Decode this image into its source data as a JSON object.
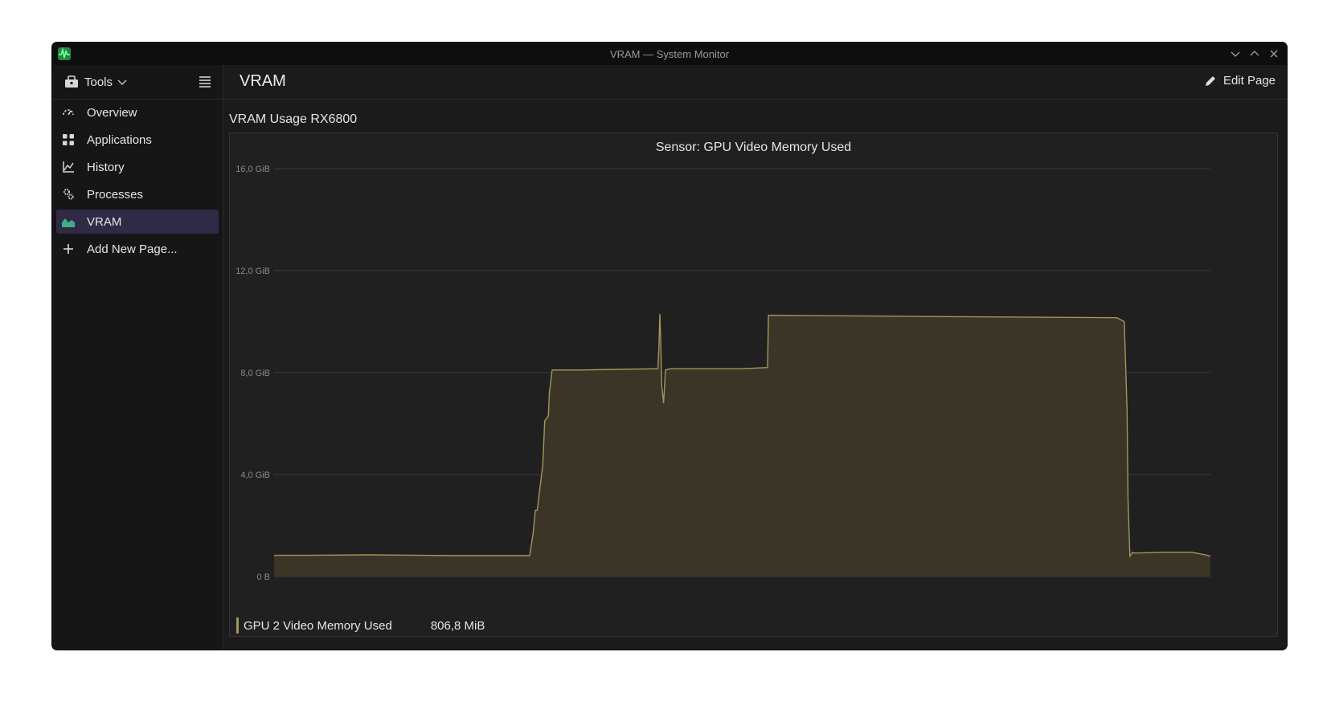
{
  "window": {
    "title": "VRAM — System Monitor"
  },
  "sidebar": {
    "tools_label": "Tools",
    "items": [
      {
        "label": "Overview",
        "icon": "overview-icon"
      },
      {
        "label": "Applications",
        "icon": "applications-grid-icon"
      },
      {
        "label": "History",
        "icon": "history-chart-icon"
      },
      {
        "label": "Processes",
        "icon": "processes-gear-icon"
      },
      {
        "label": "VRAM",
        "icon": "vram-area-chart-icon",
        "active": true
      },
      {
        "label": "Add New Page...",
        "icon": "plus-icon"
      }
    ]
  },
  "header": {
    "page_title": "VRAM",
    "edit_label": "Edit Page"
  },
  "section": {
    "title": "VRAM Usage RX6800"
  },
  "chart_data": {
    "type": "area",
    "title": "Sensor: GPU Video Memory Used",
    "ylabel": "",
    "xlabel": "",
    "ylim": [
      0,
      16
    ],
    "yticks": [
      "16,0 GiB",
      "12,0 GiB",
      "8,0 GiB",
      "4,0 GiB",
      "0 B"
    ],
    "ytick_values": [
      16,
      12,
      8,
      4,
      0
    ],
    "grid": true,
    "legend_position": "bottom-left",
    "series": [
      {
        "name": "GPU 2 Video Memory Used",
        "current_value": "806,8 MiB",
        "color": "#a3955b",
        "fill": "#3a3527",
        "x": [
          0,
          0.03,
          0.1,
          0.2,
          0.25,
          0.273,
          0.275,
          0.277,
          0.279,
          0.281,
          0.287,
          0.289,
          0.293,
          0.294,
          0.297,
          0.301,
          0.327,
          0.41,
          0.411,
          0.412,
          0.413,
          0.414,
          0.416,
          0.418,
          0.423,
          0.47,
          0.5,
          0.527,
          0.528,
          0.7,
          0.9,
          0.908,
          0.911,
          0.912,
          0.914,
          0.917,
          0.919,
          0.95,
          0.98,
          0.995,
          1.0
        ],
        "y": [
          0.83,
          0.83,
          0.85,
          0.82,
          0.82,
          0.82,
          1.3,
          1.8,
          2.6,
          2.6,
          4.4,
          6.1,
          6.3,
          7.2,
          8.1,
          8.1,
          8.1,
          8.15,
          9.0,
          10.3,
          9.2,
          7.5,
          6.8,
          8.1,
          8.15,
          8.15,
          8.15,
          8.2,
          10.25,
          10.2,
          10.15,
          10.0,
          6.5,
          3.0,
          0.8,
          0.95,
          0.92,
          0.95,
          0.95,
          0.85,
          0.8
        ]
      }
    ]
  }
}
